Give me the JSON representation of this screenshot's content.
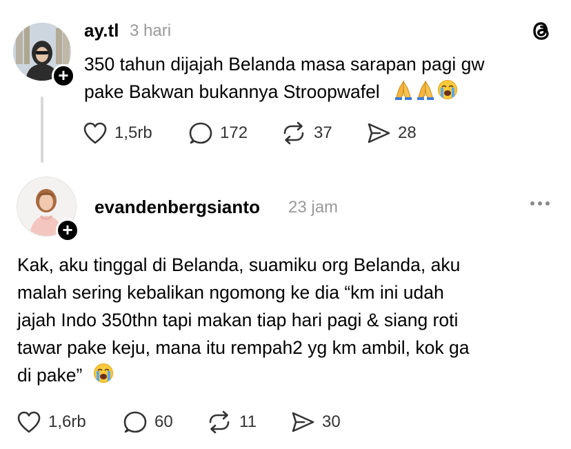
{
  "post": {
    "username": "ay.tl",
    "time": "3 hari",
    "text_lines": [
      "350 tahun dijajah Belanda masa sarapan pagi gw",
      "pake Bakwan bukannya Stroopwafel"
    ],
    "emojis": [
      "folded-hands-emoji",
      "folded-hands-emoji",
      "loudly-crying-face-emoji"
    ],
    "likes": "1,5rb",
    "replies": "172",
    "reposts": "37",
    "shares": "28"
  },
  "reply": {
    "username": "evandenbergsianto",
    "time": "23 jam",
    "text_lines": [
      "Kak, aku tinggal di Belanda, suamiku org Belanda, aku",
      "malah sering kebalikan ngomong ke dia “km ini udah",
      "jajah Indo 350thn tapi makan tiap hari pagi & siang roti",
      "tawar pake keju, mana itu rempah2 yg km ambil, kok ga",
      "di pake”"
    ],
    "emojis": [
      "loudly-crying-face-emoji"
    ],
    "likes": "1,6rb",
    "replies": "60",
    "reposts": "11",
    "shares": "30"
  },
  "icons": {
    "app_logo": "threads-logo-icon",
    "like": "heart-icon",
    "reply": "comment-bubble-icon",
    "repost": "repost-icon",
    "share": "send-icon",
    "more": "more-options-icon",
    "follow": "plus-icon"
  },
  "colors": {
    "text": "#000000",
    "secondary_text": "#999999",
    "icon": "#333333",
    "thread_line": "#d9d9d9"
  }
}
